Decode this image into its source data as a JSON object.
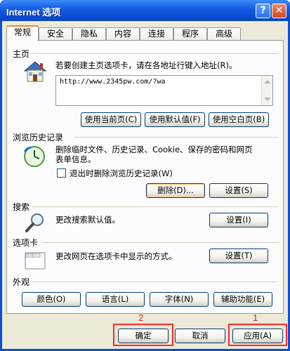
{
  "window": {
    "title": "Internet 选项",
    "help_glyph": "?",
    "close_glyph": "✕"
  },
  "tabs": [
    {
      "label": "常规",
      "active": true
    },
    {
      "label": "安全"
    },
    {
      "label": "隐私"
    },
    {
      "label": "内容"
    },
    {
      "label": "连接"
    },
    {
      "label": "程序"
    },
    {
      "label": "高级"
    }
  ],
  "homepage": {
    "heading": "主页",
    "description": "若要创建主页选项卡，请在各地址行键入地址(R)。",
    "url": "http://www.2345pw.com/?wa",
    "buttons": {
      "use_current": "使用当前页(C)",
      "use_default": "使用默认值(F)",
      "use_blank": "使用空白页(B)"
    }
  },
  "history": {
    "heading": "浏览历史记录",
    "description_line1": "删除临时文件、历史记录、Cookie、保存的密码和网页",
    "description_line2": "表单信息。",
    "checkbox_label": "退出时删除浏览历史记录(W)",
    "buttons": {
      "delete": "删除(D)...",
      "settings": "设置(S)"
    }
  },
  "search": {
    "heading": "搜索",
    "description": "更改搜索默认值。",
    "settings": "设置(I)"
  },
  "tabsection": {
    "heading": "选项卡",
    "description": "更改网页在选项卡中显示的方式。",
    "settings": "设置(T)"
  },
  "appearance": {
    "heading": "外观",
    "buttons": {
      "colors": "颜色(O)",
      "languages": "语言(L)",
      "fonts": "字体(N)",
      "accessibility": "辅助功能(E)"
    }
  },
  "footer": {
    "ok": "确定",
    "cancel": "取消",
    "apply": "应用(A)"
  },
  "annotations": {
    "ok_number": "2",
    "apply_number": "1",
    "color": "#ff2a2a"
  }
}
